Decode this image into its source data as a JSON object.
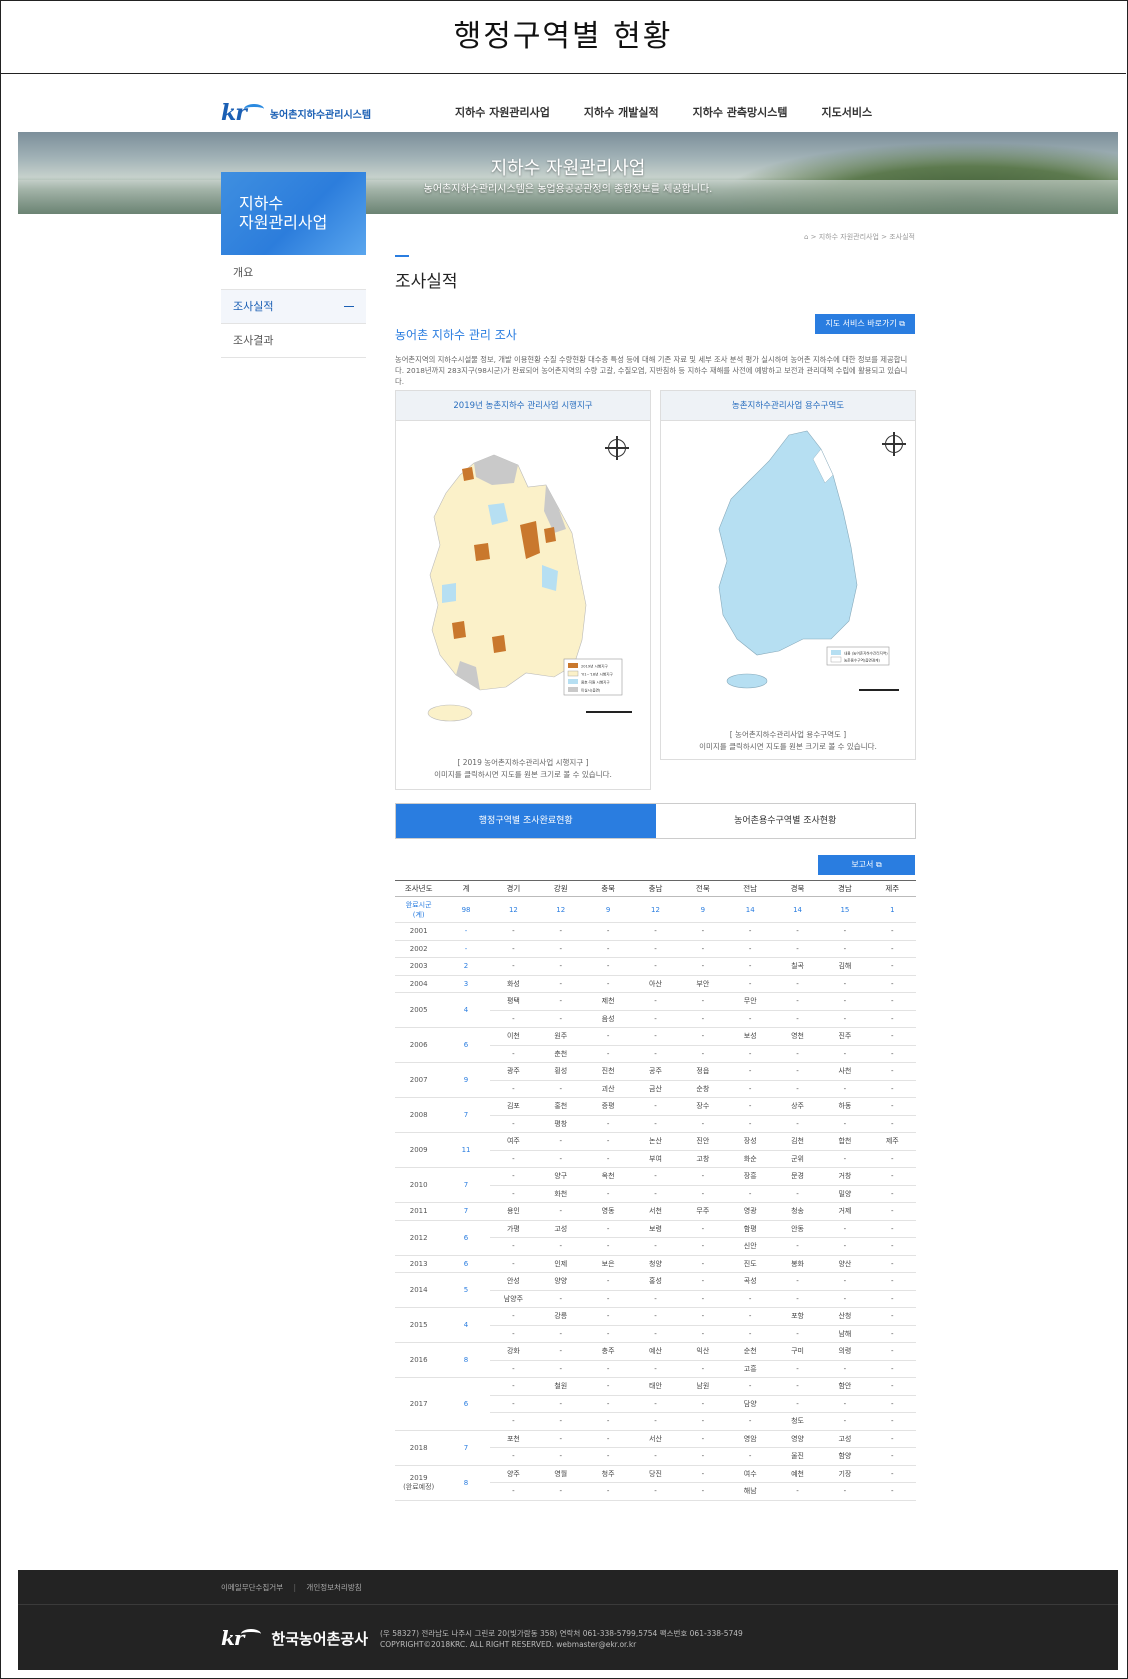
{
  "doc_title": "행정구역별 현황",
  "site": {
    "logo_text": "농어촌지하수관리시스템",
    "menu": [
      "지하수 자원관리사업",
      "지하수 개발실적",
      "지하수 관측망시스템",
      "지도서비스"
    ]
  },
  "banner": {
    "title": "지하수 자원관리사업",
    "subtitle": "농어촌지하수관리시스템은 농업용공공관정의 종합정보를 제공합니다."
  },
  "sidebar": {
    "heading_line1": "지하수",
    "heading_line2": "자원관리사업",
    "items": [
      {
        "label": "개요"
      },
      {
        "label": "조사실적"
      },
      {
        "label": "조사결과"
      }
    ]
  },
  "breadcrumb": "> 지하수 자원관리사업 > 조사실적",
  "page_title": "조사실적",
  "section": {
    "title": "농어촌 지하수 관리 조사",
    "map_button": "지도 서비스 바로가기",
    "description": "농어촌지역의 지하수시설물 정보, 개발 이용현황 수질 수량현황 대수층 특성 등에 대해 기존 자료 및 세부 조사 분석 평가 실시하여 농어촌 지하수에 대한 정보를 제공합니다. 2018년까지 283지구(98시군)가 완료되어 농어촌지역의 수량 고갈, 수질오염, 지반침하 등 지하수 재해를 사전에 예방하고 보전과 관리대책 수립에 활용되고 있습니다."
  },
  "maps": [
    {
      "title": "2019년 농촌지하수 관리사업 시행지구",
      "caption1": "[ 2019 농어촌지하수관리사업 시행지구 ]",
      "caption2": "이미지를 클릭하시면 지도를 원본 크기로 볼 수 있습니다.",
      "legend": [
        "2019년 시행지구",
        "'01~'18년 시행지구",
        "용호·지원 시행지구",
        "미실시(읍면)"
      ],
      "legend_colors": [
        "#c9782d",
        "#fbf1c9",
        "#b6dff2",
        "#c9c9c9"
      ]
    },
    {
      "title": "농촌지하수관리사업 용수구역도",
      "caption1": "[ 농어촌지하수관리사업 용수구역도 ]",
      "caption2": "이미지를 클릭하시면 지도를 원본 크기로 볼 수 있습니다.",
      "legend": [
        "내용 (농어촌지하수관리지역)",
        "농촌용수구역(읍면경계)"
      ],
      "legend_colors": [
        "#b6dff2",
        "#ffffff"
      ]
    }
  ],
  "tabs": [
    "행정구역별 조사완료현황",
    "농어촌용수구역별 조사현황"
  ],
  "report_button": "보고서",
  "table": {
    "headers": [
      "조사년도",
      "계",
      "경기",
      "강원",
      "충북",
      "충남",
      "전북",
      "전남",
      "경북",
      "경남",
      "제주"
    ],
    "completion_label_line1": "완료시군",
    "completion_label_line2": "(계)",
    "completion": [
      "98",
      "12",
      "12",
      "9",
      "12",
      "9",
      "14",
      "14",
      "15",
      "1"
    ],
    "years": [
      {
        "year": "2001",
        "total": "-",
        "rows": [
          [
            "-",
            "-",
            "-",
            "-",
            "-",
            "-",
            "-",
            "-",
            "-"
          ]
        ]
      },
      {
        "year": "2002",
        "total": "-",
        "rows": [
          [
            "-",
            "-",
            "-",
            "-",
            "-",
            "-",
            "-",
            "-",
            "-"
          ]
        ]
      },
      {
        "year": "2003",
        "total": "2",
        "rows": [
          [
            "-",
            "-",
            "-",
            "-",
            "-",
            "-",
            "칠곡",
            "김해",
            "-"
          ]
        ]
      },
      {
        "year": "2004",
        "total": "3",
        "rows": [
          [
            "화성",
            "-",
            "-",
            "아산",
            "부안",
            "-",
            "-",
            "-",
            "-"
          ]
        ]
      },
      {
        "year": "2005",
        "total": "4",
        "rows": [
          [
            "평택",
            "-",
            "제천",
            "-",
            "-",
            "무안",
            "-",
            "-",
            "-"
          ],
          [
            "-",
            "-",
            "음성",
            "-",
            "-",
            "-",
            "-",
            "-",
            "-"
          ]
        ]
      },
      {
        "year": "2006",
        "total": "6",
        "rows": [
          [
            "이천",
            "원주",
            "-",
            "-",
            "-",
            "보성",
            "영천",
            "진주",
            "-"
          ],
          [
            "-",
            "춘천",
            "-",
            "-",
            "-",
            "-",
            "-",
            "-",
            "-"
          ]
        ]
      },
      {
        "year": "2007",
        "total": "9",
        "rows": [
          [
            "광주",
            "횡성",
            "진천",
            "공주",
            "정읍",
            "-",
            "-",
            "사천",
            "-"
          ],
          [
            "-",
            "-",
            "괴산",
            "금산",
            "순창",
            "-",
            "-",
            "-",
            "-"
          ]
        ]
      },
      {
        "year": "2008",
        "total": "7",
        "rows": [
          [
            "김포",
            "홍천",
            "증평",
            "-",
            "장수",
            "-",
            "상주",
            "하동",
            "-"
          ],
          [
            "-",
            "평창",
            "-",
            "-",
            "-",
            "-",
            "-",
            "-",
            "-"
          ]
        ]
      },
      {
        "year": "2009",
        "total": "11",
        "rows": [
          [
            "여주",
            "-",
            "-",
            "논산",
            "진안",
            "장성",
            "김천",
            "합천",
            "제주"
          ],
          [
            "-",
            "-",
            "-",
            "부여",
            "고창",
            "화순",
            "군위",
            "-",
            "-"
          ]
        ]
      },
      {
        "year": "2010",
        "total": "7",
        "rows": [
          [
            "-",
            "양구",
            "옥천",
            "-",
            "-",
            "장흥",
            "문경",
            "거창",
            "-"
          ],
          [
            "-",
            "화천",
            "-",
            "-",
            "-",
            "-",
            "-",
            "밀양",
            "-"
          ]
        ]
      },
      {
        "year": "2011",
        "total": "7",
        "rows": [
          [
            "용인",
            "-",
            "영동",
            "서천",
            "무주",
            "영광",
            "청송",
            "거제",
            "-"
          ]
        ]
      },
      {
        "year": "2012",
        "total": "6",
        "rows": [
          [
            "가평",
            "고성",
            "-",
            "보령",
            "-",
            "함평",
            "안동",
            "-",
            "-"
          ],
          [
            "-",
            "-",
            "-",
            "-",
            "-",
            "신안",
            "-",
            "-",
            "-"
          ]
        ]
      },
      {
        "year": "2013",
        "total": "6",
        "rows": [
          [
            "-",
            "인제",
            "보은",
            "청양",
            "-",
            "진도",
            "봉화",
            "양산",
            "-"
          ]
        ]
      },
      {
        "year": "2014",
        "total": "5",
        "rows": [
          [
            "안성",
            "양양",
            "-",
            "홍성",
            "-",
            "곡성",
            "-",
            "-",
            "-"
          ],
          [
            "남양주",
            "-",
            "-",
            "-",
            "-",
            "-",
            "-",
            "-",
            "-"
          ]
        ]
      },
      {
        "year": "2015",
        "total": "4",
        "rows": [
          [
            "-",
            "강릉",
            "-",
            "-",
            "-",
            "-",
            "포항",
            "산청",
            "-"
          ],
          [
            "-",
            "-",
            "-",
            "-",
            "-",
            "-",
            "-",
            "남해",
            "-"
          ]
        ]
      },
      {
        "year": "2016",
        "total": "8",
        "rows": [
          [
            "강화",
            "-",
            "충주",
            "예산",
            "익산",
            "순천",
            "구미",
            "의령",
            "-"
          ],
          [
            "-",
            "-",
            "-",
            "-",
            "-",
            "고흥",
            "-",
            "-",
            "-"
          ]
        ]
      },
      {
        "year": "2017",
        "total": "6",
        "rows": [
          [
            "-",
            "철원",
            "-",
            "태안",
            "남원",
            "-",
            "-",
            "함안",
            "-"
          ],
          [
            "-",
            "-",
            "-",
            "-",
            "-",
            "담양",
            "-",
            "-",
            "-"
          ],
          [
            "-",
            "-",
            "-",
            "-",
            "-",
            "-",
            "청도",
            "-",
            "-"
          ]
        ]
      },
      {
        "year": "2018",
        "total": "7",
        "rows": [
          [
            "포천",
            "-",
            "-",
            "서산",
            "-",
            "영암",
            "영양",
            "고성",
            "-"
          ],
          [
            "-",
            "-",
            "-",
            "-",
            "-",
            "-",
            "울진",
            "함양",
            "-"
          ]
        ]
      },
      {
        "year": "2019",
        "year_sub": "(완료예정)",
        "total": "8",
        "rows": [
          [
            "양주",
            "영월",
            "청주",
            "당진",
            "-",
            "여수",
            "예천",
            "기장",
            "-"
          ],
          [
            "-",
            "-",
            "-",
            "-",
            "-",
            "해남",
            "-",
            "-",
            "-"
          ]
        ]
      }
    ]
  },
  "footer": {
    "links": [
      "이메일무단수집거부",
      "개인정보처리방침"
    ],
    "company": "한국농어촌공사",
    "address": "(우 58327) 전라남도 나주시 그린로 20(빛가람동 358) 연락처 061-338-5799,5754   팩스번호 061-338-5749",
    "copyright": "COPYRIGHT©2018KRC. ALL RIGHT RESERVED. webmaster@ekr.or.kr"
  },
  "colors": {
    "accent": "#2a7de0",
    "footer_bg": "#232323"
  }
}
